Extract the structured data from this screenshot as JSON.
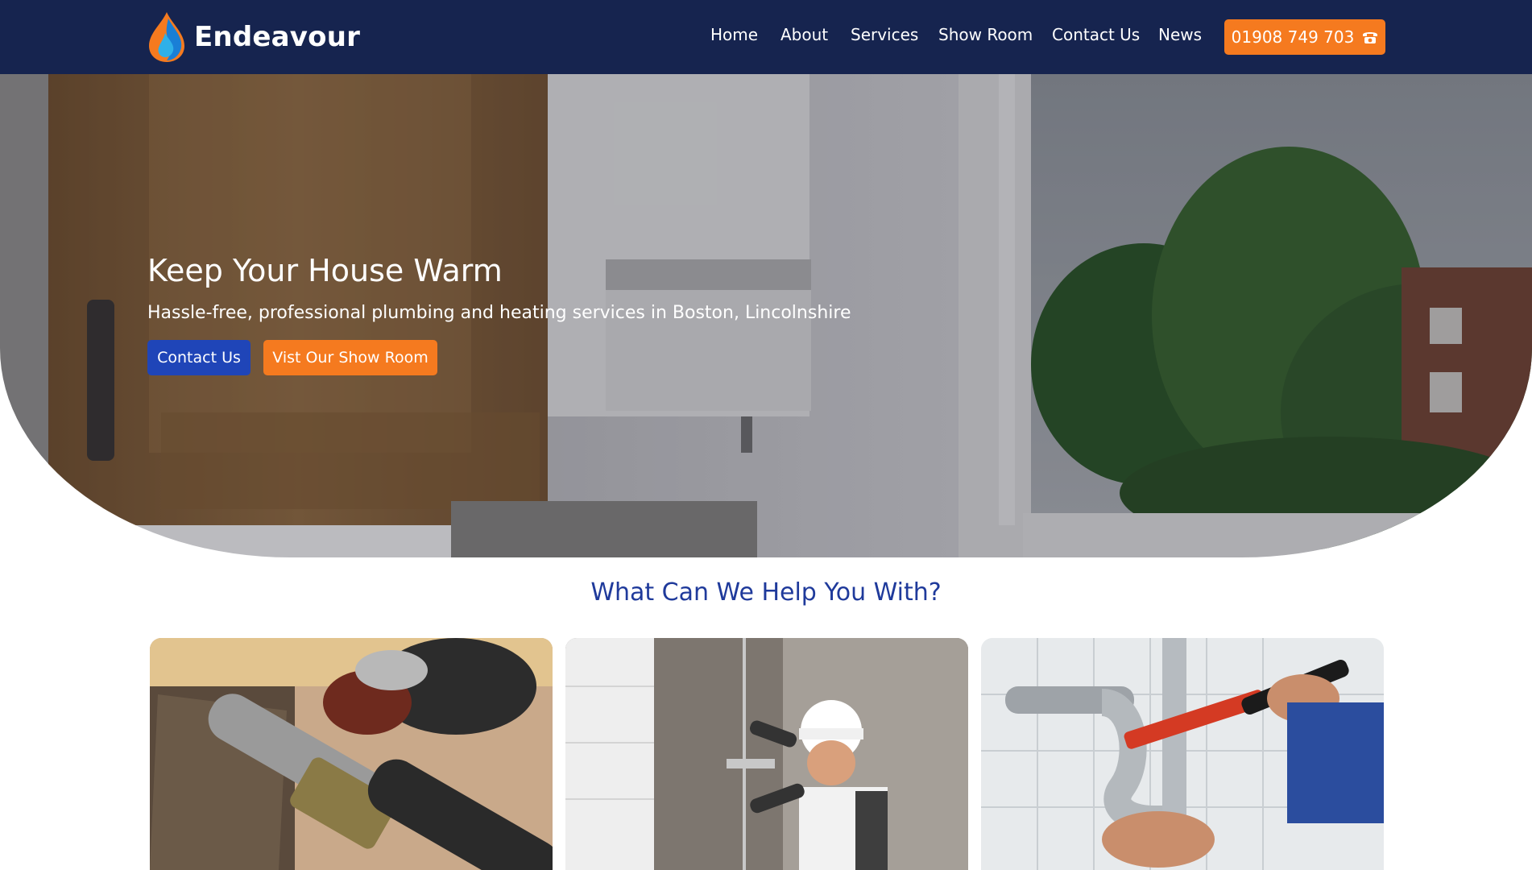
{
  "brand": {
    "name": "Endeavour"
  },
  "nav": {
    "items": [
      "Home",
      "About",
      "Services",
      "Show Room",
      "Contact Us",
      "News"
    ],
    "phone": "01908 749 703"
  },
  "hero": {
    "title": "Keep Your House Warm",
    "subtitle": "Hassle-free, professional plumbing and heating services in Boston, Lincolnshire",
    "primary_button": "Contact Us",
    "secondary_button": "Vist Our Show Room"
  },
  "services": {
    "title": "What Can We Help You With?"
  },
  "colors": {
    "header_bg": "#16244f",
    "accent_orange": "#f57a1f",
    "button_blue": "#1f45b8",
    "heading_blue": "#1f3a9b"
  }
}
